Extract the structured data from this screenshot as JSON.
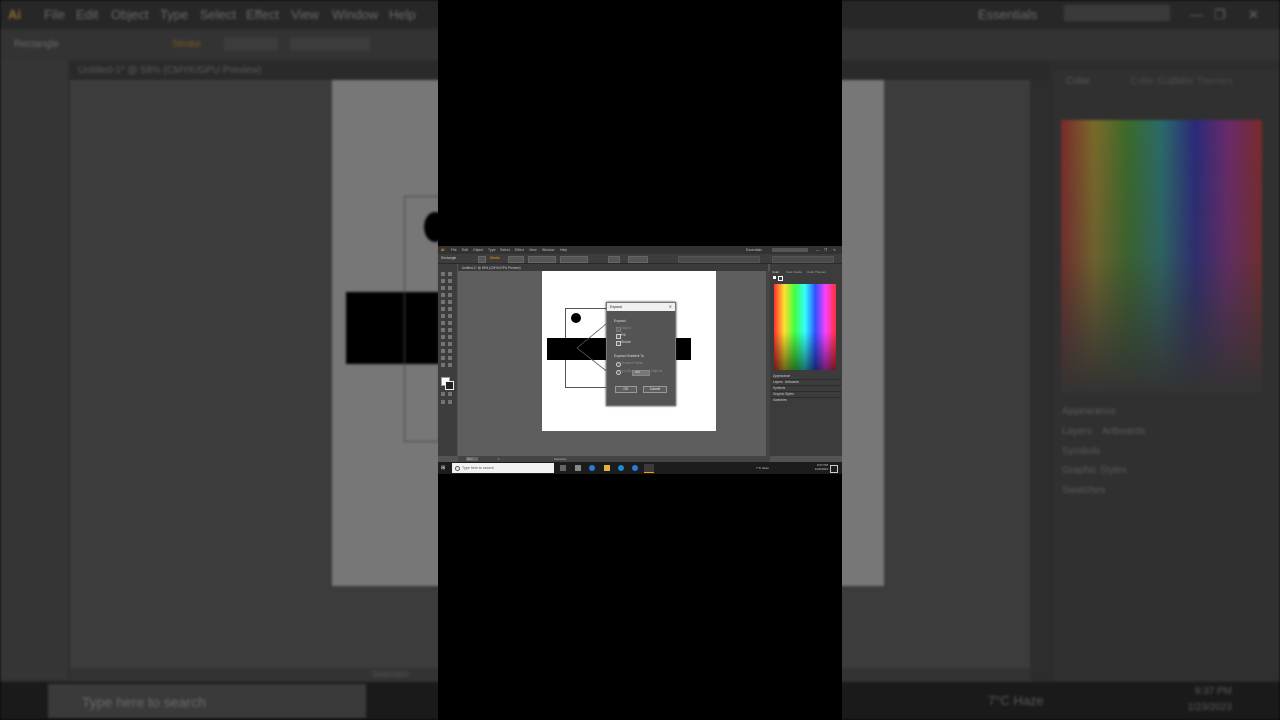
{
  "app": {
    "logo": "Ai",
    "menu": [
      "File",
      "Edit",
      "Object",
      "Type",
      "Select",
      "Effect",
      "View",
      "Window",
      "Help"
    ],
    "workspace": "Essentials",
    "tool_name": "Rectangle",
    "stroke_label": "Stroke",
    "stroke_weight": "1 pt",
    "stroke_profile": "Uniform",
    "doc_tab": "Untitled-1* @ 59% (CMYK/GPU Preview)",
    "zoom": "59%",
    "artboard_nav": "1",
    "status_text": "Selection"
  },
  "panels": {
    "color_tabs": [
      "Color",
      "Color Guide",
      "Color Themes"
    ],
    "list": [
      "Appearance",
      "Layers",
      "Artboards",
      "Symbols",
      "Graphic Styles",
      "Swatches"
    ]
  },
  "dialog": {
    "title": "Expand",
    "close": "✕",
    "section_expand": "Expand",
    "opt_object": "Object",
    "opt_fill": "Fill",
    "opt_stroke": "Stroke",
    "section_gradient": "Expand Gradient To",
    "opt_gradient_mesh": "Gradient Mesh",
    "opt_specify": "Specify:",
    "specify_value": "255",
    "specify_unit": "Objects",
    "ok": "OK",
    "cancel": "Cancel"
  },
  "taskbar": {
    "search_placeholder": "Type here to search",
    "weather": "7°C  Haze",
    "time": "9:37 PM",
    "date": "1/23/2023"
  },
  "colors": {
    "accent": "#ff9a00",
    "ui_dark": "#323232",
    "canvas": "#535353"
  }
}
